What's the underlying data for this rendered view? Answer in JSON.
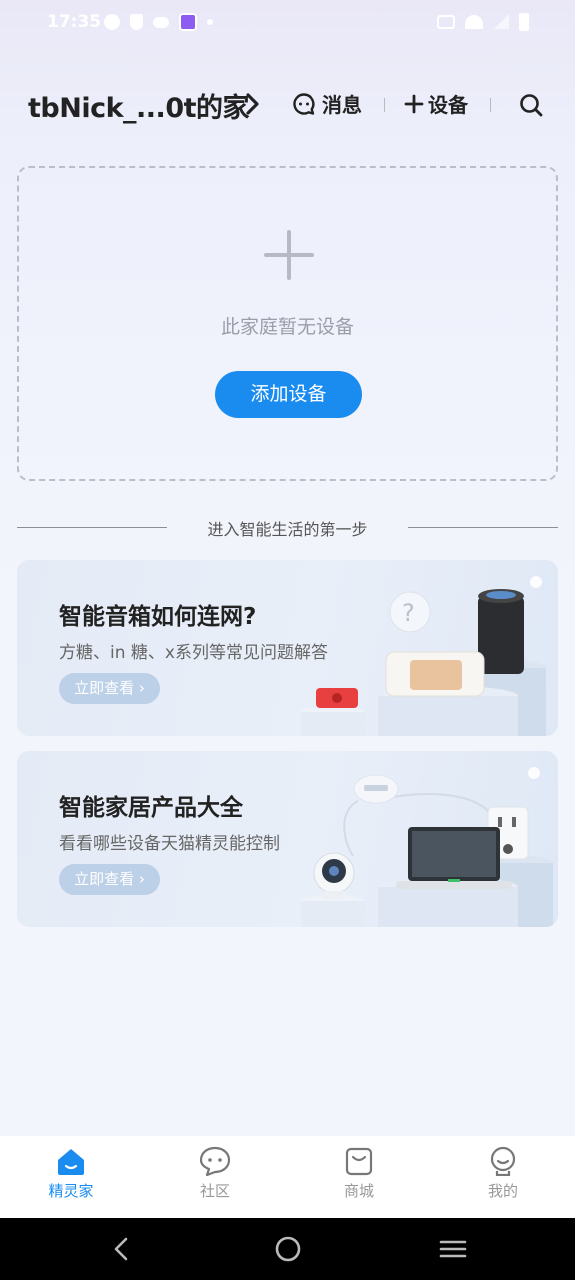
{
  "status_bar": {
    "time": "17:35",
    "icons": [
      "check-circle-icon",
      "shield-icon",
      "cloud-icon",
      "app-icon",
      "dot-icon",
      "vibrate-icon",
      "wifi-icon",
      "signal-icon",
      "battery-icon"
    ]
  },
  "header": {
    "home_name": "tbNick_...0t的家",
    "messages_label": "消息",
    "add_device_label": "设备"
  },
  "empty_state": {
    "message": "此家庭暂无设备",
    "add_button": "添加设备"
  },
  "section_divider": "进入智能生活的第一步",
  "cards": [
    {
      "title": "智能音箱如何连网?",
      "subtitle": "方糖、in 糖、x系列等常见问题解答",
      "button": "立即查看"
    },
    {
      "title": "智能家居产品大全",
      "subtitle": "看看哪些设备天猫精灵能控制",
      "button": "立即查看"
    }
  ],
  "tabbar": {
    "items": [
      {
        "label": "精灵家",
        "active": true
      },
      {
        "label": "社区",
        "active": false
      },
      {
        "label": "商城",
        "active": false
      },
      {
        "label": "我的",
        "active": false
      }
    ]
  },
  "colors": {
    "accent": "#1a8cf0",
    "inactive_tab": "#999999"
  }
}
